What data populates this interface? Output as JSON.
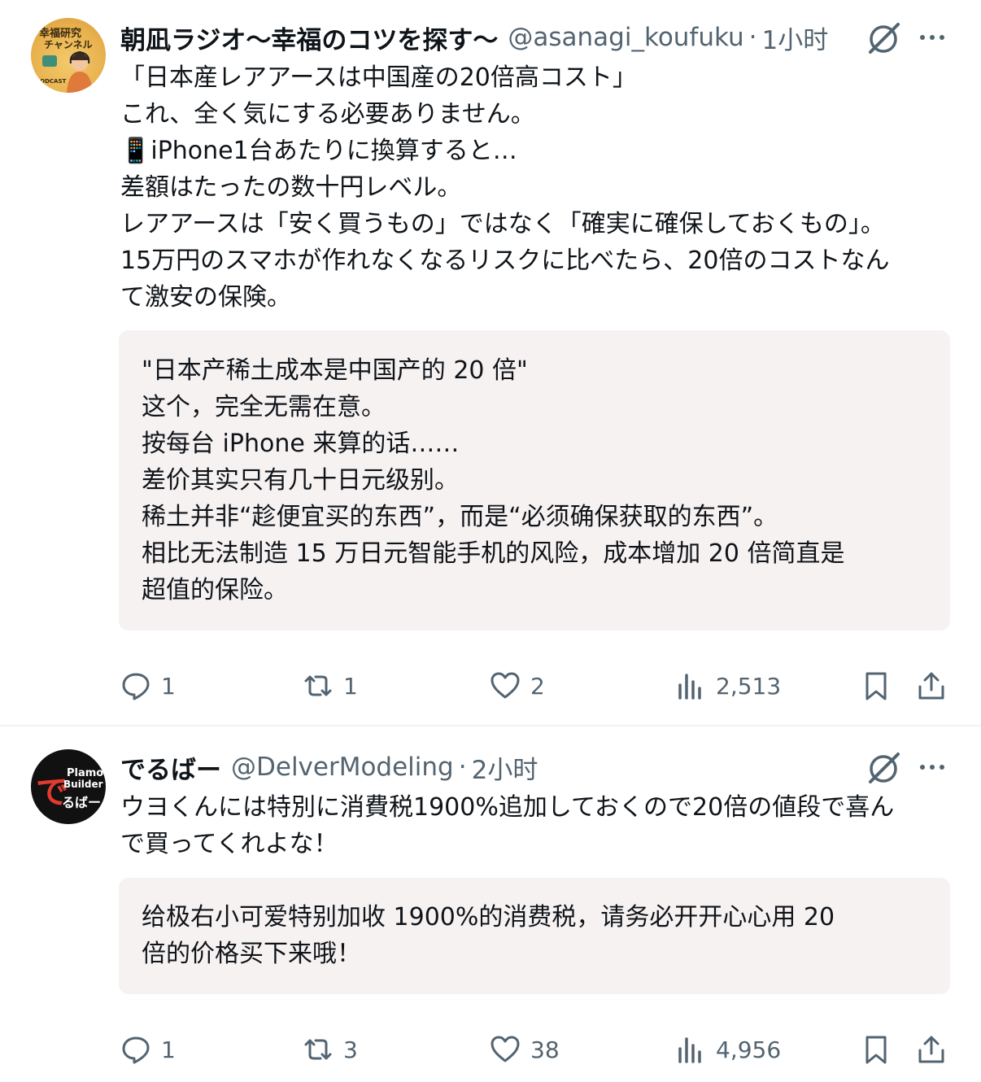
{
  "posts": [
    {
      "author": {
        "name": "朝凪ラジオ〜幸福のコツを探す〜",
        "handle": "@asanagi_koufuku",
        "time": "1小时",
        "avatar_text": [
          "幸福研究",
          "チャンネル",
          "PODCAST"
        ]
      },
      "body": [
        "「日本産レアアースは中国産の20倍高コスト」",
        "これ、全く気にする必要ありません。",
        "📱iPhone1台あたりに換算すると…",
        "差額はたったの数十円レベル。",
        "レアアースは「安く買うもの」ではなく「確実に確保しておくもの」。",
        "15万円のスマホが作れなくなるリスクに比べたら、20倍のコストなん",
        "て激安の保険。"
      ],
      "translation": [
        "\"日本产稀土成本是中国产的 20 倍\"",
        "这个，完全无需在意。",
        "按每台 iPhone 来算的话……",
        "差价其实只有几十日元级别。",
        "稀土并非“趁便宜买的东西”，而是“必须确保获取的东西”。",
        "相比无法制造 15 万日元智能手机的风险，成本增加 20 倍简直是",
        "超值的保险。"
      ],
      "stats": {
        "replies": "1",
        "reposts": "1",
        "likes": "2",
        "views": "2,513"
      }
    },
    {
      "author": {
        "name": "でるばー",
        "handle": "@DelverModeling",
        "time": "2小时",
        "avatar_text": [
          "Plamo",
          "Builder",
          "で",
          "るばー"
        ]
      },
      "body": [
        "ウヨくんには特別に消費税1900%追加しておくので20倍の値段で喜ん",
        "で買ってくれよな！"
      ],
      "translation": [
        "给极右小可爱特别加收 1900%的消费税，请务必开开心心用 20",
        "倍的价格买下来哦！"
      ],
      "stats": {
        "replies": "1",
        "reposts": "3",
        "likes": "38",
        "views": "4,956"
      }
    }
  ],
  "colors": {
    "text": "#0f1419",
    "secondary": "#536471",
    "translation_bg": "#f7f2f2",
    "separator": "#eff3f4"
  },
  "icons": [
    "grok-icon",
    "more-icon",
    "reply-icon",
    "repost-icon",
    "like-icon",
    "views-icon",
    "bookmark-icon",
    "share-icon"
  ]
}
